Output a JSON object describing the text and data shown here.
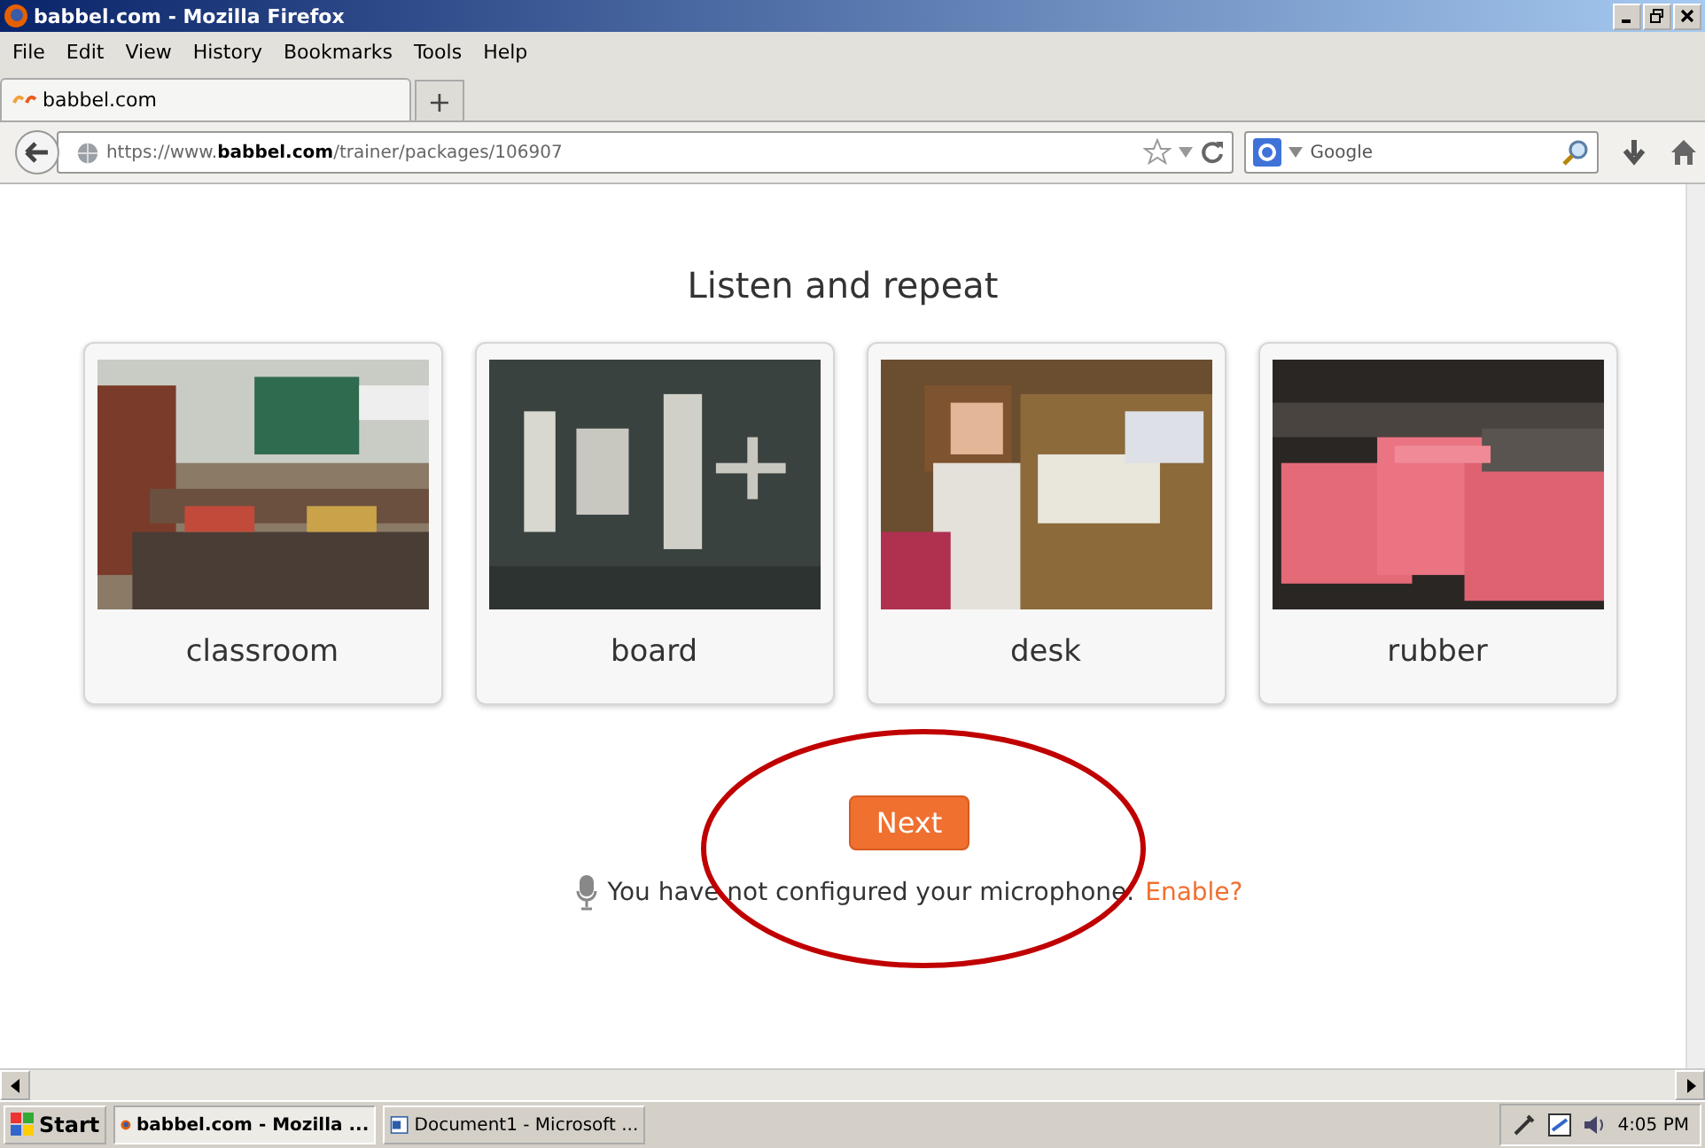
{
  "window": {
    "title": "babbel.com - Mozilla Firefox"
  },
  "menu": [
    "File",
    "Edit",
    "View",
    "History",
    "Bookmarks",
    "Tools",
    "Help"
  ],
  "tabs": [
    {
      "label": "babbel.com",
      "selected": true
    }
  ],
  "new_tab": "+",
  "address_bar": {
    "value": "https://www.**babbel.com**/trainer/packages/106907"
  },
  "search": {
    "placeholder": "Google"
  },
  "page": {
    "heading": "Listen and repeat",
    "cards": [
      {
        "word": "classroom",
        "kind": "picture"
      },
      {
        "word": "board",
        "kind": "picture"
      },
      {
        "word": "desk",
        "kind": "picture"
      },
      {
        "word": "rubber",
        "kind": "picture"
      }
    ],
    "next_button": "Next",
    "notice": "You have not configured your microphone.",
    "enable_link": "Enable?"
  },
  "taskbar": {
    "start": "Start",
    "items": [
      {
        "label": "babbel.com - Mozilla ...",
        "selected": true
      },
      {
        "label": "Document1 - Microsoft ...",
        "selected": false
      }
    ],
    "clock": "4:05 PM"
  }
}
